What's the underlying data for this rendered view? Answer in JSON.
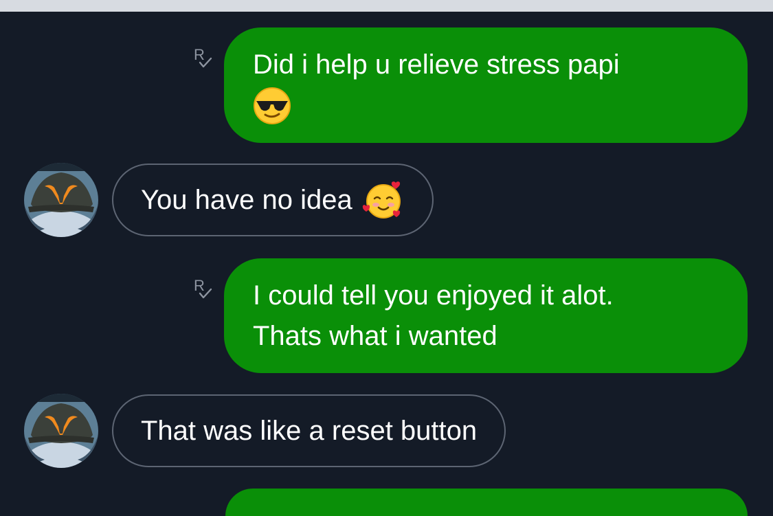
{
  "messages": [
    {
      "direction": "outgoing",
      "text": "Did i help u relieve stress papi",
      "emoji": "sunglasses-face",
      "receipt": "R"
    },
    {
      "direction": "incoming",
      "text": "You have no idea",
      "emoji": "smiling-face-with-hearts"
    },
    {
      "direction": "outgoing",
      "text_line1": "I could tell you enjoyed it alot.",
      "text_line2": "Thats what i wanted",
      "receipt": "R"
    },
    {
      "direction": "incoming",
      "text": "That was like a reset button"
    }
  ],
  "colors": {
    "background": "#141b27",
    "outgoing_bubble": "#0a8f08",
    "incoming_border": "#5d6573",
    "top_strip": "#d7dbe1"
  }
}
